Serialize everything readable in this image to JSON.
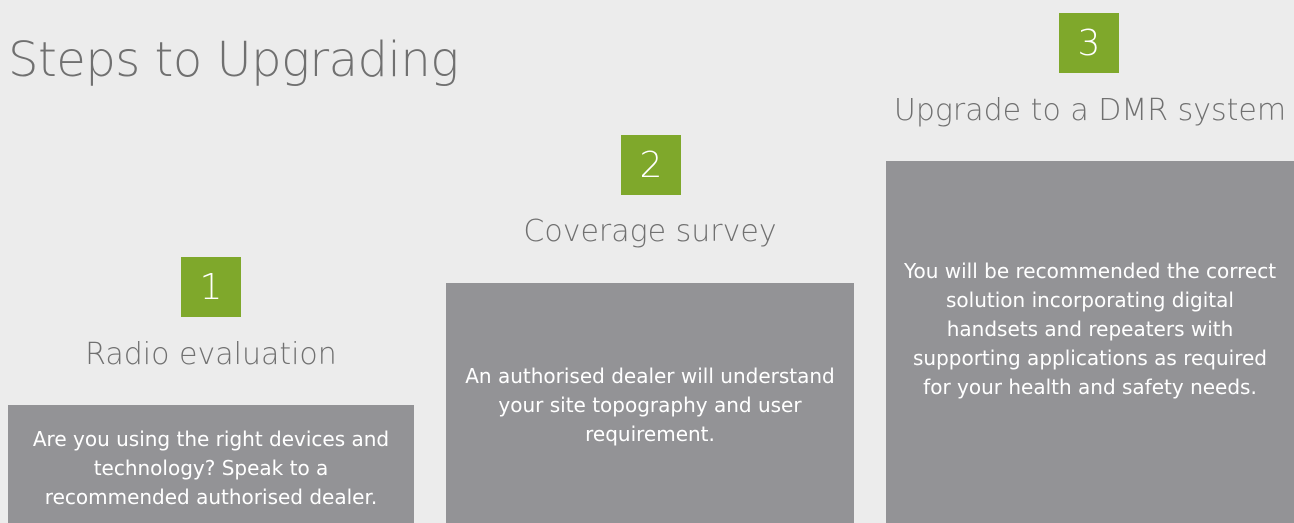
{
  "title": "Steps to Upgrading",
  "colors": {
    "background": "#ececec",
    "badge": "#7fa82b",
    "panel": "#939396",
    "heading_text": "#707070",
    "panel_text": "#ffffff"
  },
  "steps": [
    {
      "number": "1",
      "heading": "Radio evaluation",
      "description": "Are you using the right devices and technology? Speak to a recommended authorised dealer."
    },
    {
      "number": "2",
      "heading": "Coverage survey",
      "description": "An authorised dealer will understand your site topography and user requirement."
    },
    {
      "number": "3",
      "heading": "Upgrade to a DMR system",
      "description": "You will be recommended the correct solution incorporating digital handsets and repeaters with supporting applications as required for your health and safety needs."
    }
  ]
}
